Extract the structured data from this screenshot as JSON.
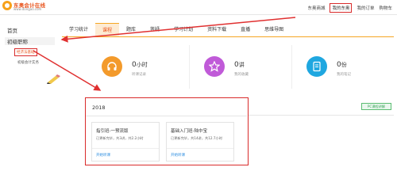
{
  "header": {
    "logo_title": "东奥会计在线",
    "logo_sub": "www.dongao.com",
    "nav": [
      {
        "label": "东奥商城",
        "active": false
      },
      {
        "label": "我的东奥",
        "active": true
      },
      {
        "label": "我的订单",
        "active": false
      },
      {
        "label": "购物车",
        "active": false
      }
    ]
  },
  "sidebar": {
    "home": "首页",
    "category": "初级职称",
    "sub_active": "经济法基础",
    "sub_other": "初级会计实务"
  },
  "tabs": [
    {
      "label": "学习统计",
      "active": false
    },
    {
      "label": "课程",
      "active": true
    },
    {
      "label": "题库",
      "active": false
    },
    {
      "label": "答疑",
      "active": false
    },
    {
      "label": "学习计划",
      "active": false
    },
    {
      "label": "资料下载",
      "active": false
    },
    {
      "label": "直播",
      "active": false
    },
    {
      "label": "思维导图",
      "active": false
    }
  ],
  "stats": [
    {
      "value": "0",
      "unit": "小时",
      "label": "听课记录",
      "icon": "headphones-icon",
      "color": "#f39a2b"
    },
    {
      "value": "0",
      "unit": "讲",
      "label": "我的收藏",
      "icon": "star-icon",
      "color": "#c05ad8"
    },
    {
      "value": "0",
      "unit": "份",
      "label": "我的笔记",
      "icon": "note-icon",
      "color": "#1fa7e0"
    }
  ],
  "courses": {
    "year": "2018",
    "items": [
      {
        "title": "指引班-一预流版",
        "meta": "已更新完毕，共3讲，共2.2小时",
        "action": "开始听课"
      },
      {
        "title": "基础入门班-陆中宝",
        "meta": "已更新完毕，共14讲，共12.7小时",
        "action": "开始听课"
      }
    ]
  },
  "pc_button": "PC课程讲解",
  "colors": {
    "accent": "#e8551e",
    "highlight": "#d92b2b",
    "tab_underline": "#f5a623",
    "link": "#2f8fe0"
  }
}
